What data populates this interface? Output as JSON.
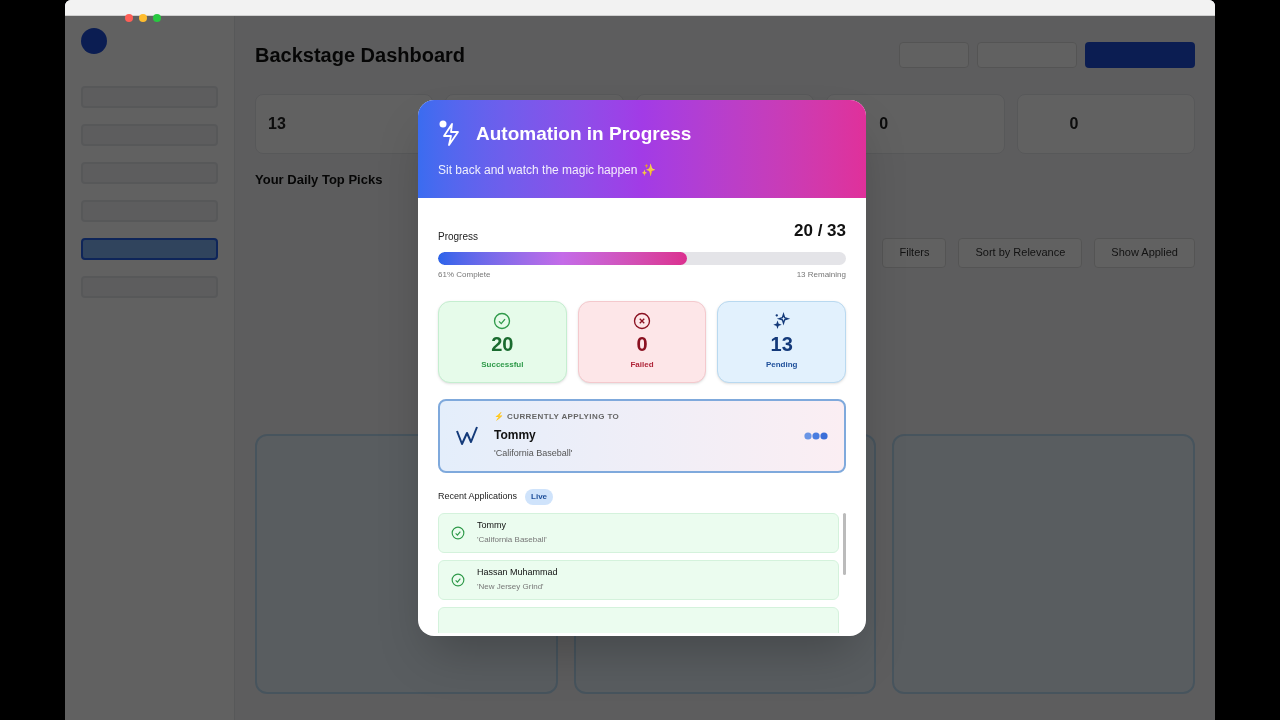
{
  "background": {
    "sidebar": [
      {
        "selected": false
      },
      {
        "selected": false
      },
      {
        "selected": false
      },
      {
        "selected": false
      },
      {
        "selected": true
      },
      {
        "selected": false
      }
    ],
    "title": "Backstage Dashboard",
    "stats": [
      "13",
      "0",
      "0"
    ],
    "section_title": "Your Daily Top Picks",
    "controls": [
      "Filters",
      "Sort by Relevance",
      "Show Applied"
    ]
  },
  "modal": {
    "title": "Automation in Progress",
    "subtitle": "Sit back and watch the magic happen ✨",
    "progress": {
      "label": "Progress",
      "count": "20 / 33",
      "level": 0.61,
      "percent_text": "61% Complete",
      "remaining_text": "13 Remaining"
    },
    "stats": [
      {
        "kind": "success",
        "value": "20",
        "label": "Successful"
      },
      {
        "kind": "failed",
        "value": "0",
        "label": "Failed"
      },
      {
        "kind": "pending",
        "value": "13",
        "label": "Pending"
      }
    ],
    "current": {
      "caption": "⚡ CURRENTLY APPLYING TO",
      "name": "Tommy",
      "project": "'California Baseball'"
    },
    "recent": {
      "title": "Recent Applications",
      "badge": "Live",
      "items": [
        {
          "name": "Tommy",
          "project": "'California Baseball'"
        },
        {
          "name": "Hassan Muhammad",
          "project": "'New Jersey Grind'"
        }
      ]
    }
  }
}
